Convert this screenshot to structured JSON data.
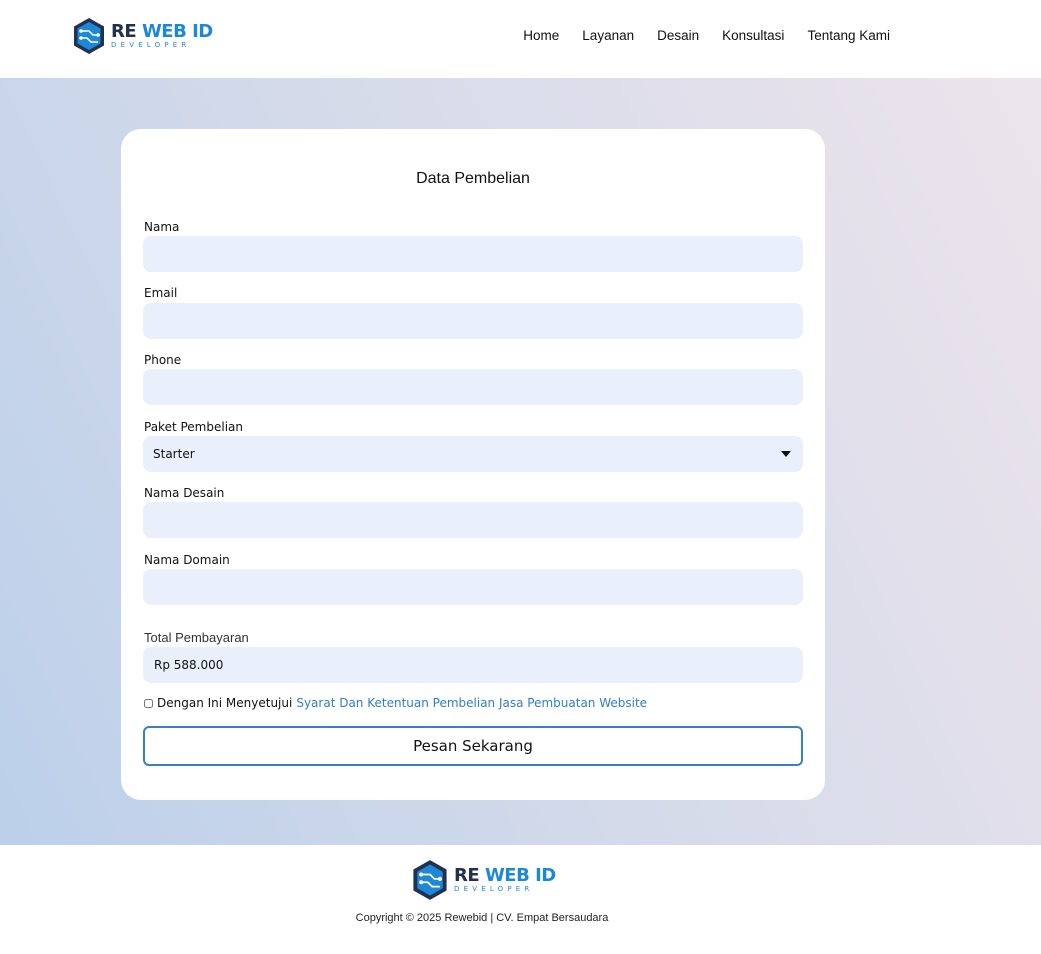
{
  "brand": {
    "name_part1": "RE",
    "name_part2": "WEB ID",
    "tagline": "DEVELOPER",
    "colors": {
      "dark": "#22314f",
      "blue": "#1e88d8"
    }
  },
  "nav": {
    "items": [
      "Home",
      "Layanan",
      "Desain",
      "Konsultasi",
      "Tentang Kami"
    ]
  },
  "form": {
    "title": "Data Pembelian",
    "fields": {
      "nama": {
        "label": "Nama",
        "value": ""
      },
      "email": {
        "label": "Email",
        "value": ""
      },
      "phone": {
        "label": "Phone",
        "value": ""
      },
      "paket": {
        "label": "Paket Pembelian",
        "selected": "Starter"
      },
      "desain": {
        "label": "Nama Desain",
        "value": ""
      },
      "domain": {
        "label": "Nama Domain",
        "value": ""
      }
    },
    "total_label": "Total Pembayaran",
    "total_value": "Rp 588.000",
    "agree_text": "Dengan Ini Menyetujui",
    "agree_link": "Syarat Dan Ketentuan Pembelian Jasa Pembuatan Website",
    "submit_label": "Pesan Sekarang"
  },
  "footer": {
    "copyright": "Copyright © 2025 Rewebid | CV. Empat Bersaudara"
  },
  "colors": {
    "input_bg": "#eaf0fb",
    "link": "#2f7fc1",
    "button_border": "#3a7fbf"
  }
}
